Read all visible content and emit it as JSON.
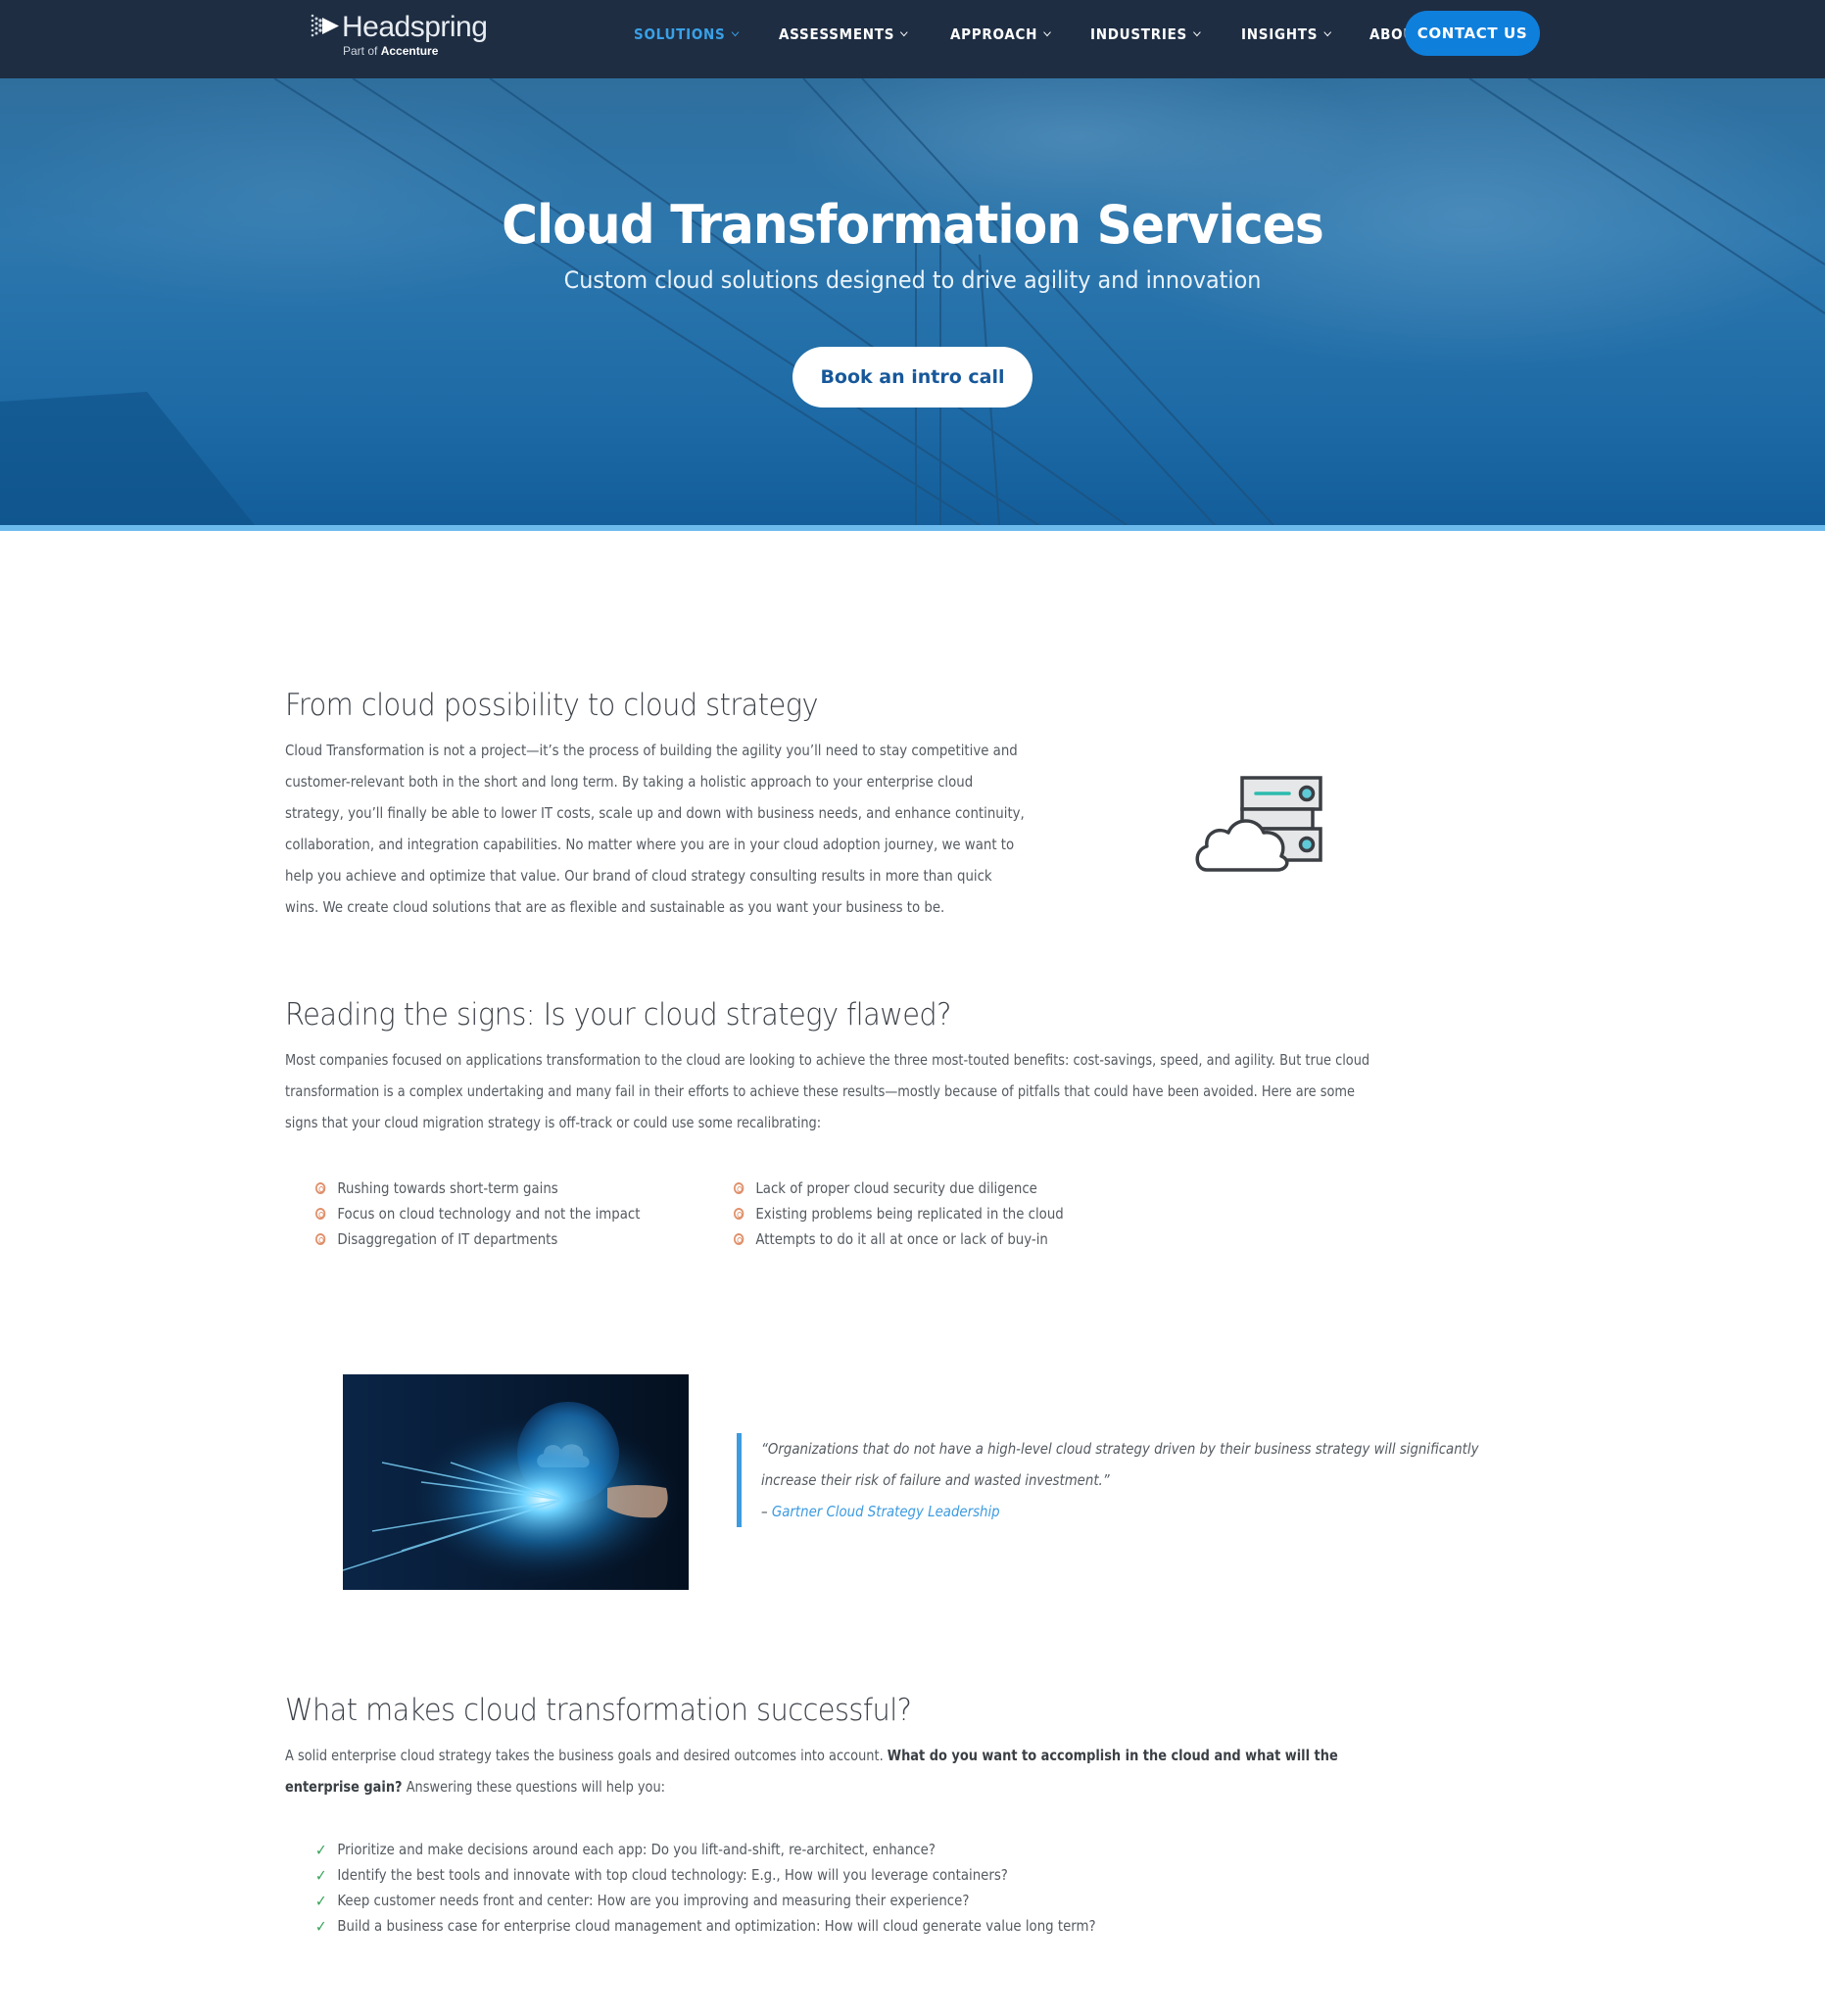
{
  "nav": {
    "logo": {
      "name": "Headspring",
      "sub_prefix": "Part of",
      "sub_brand": "Accenture"
    },
    "items": [
      {
        "label": "SOLUTIONS",
        "active": true
      },
      {
        "label": "ASSESSMENTS",
        "active": false
      },
      {
        "label": "APPROACH",
        "active": false
      },
      {
        "label": "INDUSTRIES",
        "active": false
      },
      {
        "label": "INSIGHTS",
        "active": false
      },
      {
        "label": "ABOUT",
        "active": false
      }
    ],
    "contact_label": "CONTACT US"
  },
  "hero": {
    "title": "Cloud Transformation Services",
    "subtitle": "Custom cloud solutions designed to drive agility and innovation",
    "cta_label": "Book an intro call"
  },
  "section1": {
    "heading": "From cloud possibility to cloud strategy",
    "lines": [
      "Cloud Transformation is not a project—it’s the process of building the agility you’ll need to stay competitive and",
      "customer-relevant both in the short and long term. By taking a holistic approach to your enterprise cloud",
      "strategy, you’ll finally be able to lower IT costs, scale up and down with business needs, and enhance continuity,",
      "collaboration, and integration capabilities. No matter where you are in your cloud adoption journey, we want to",
      "help you achieve and optimize that value. Our brand of cloud strategy consulting results in more than quick",
      "wins. We create cloud solutions that are as flexible and sustainable as you want your business to be."
    ],
    "icon": "cloud-server-icon"
  },
  "section2": {
    "heading": "Reading the signs: Is your cloud strategy flawed?",
    "lines": [
      "Most companies focused on applications transformation to the cloud are looking to achieve the three most-touted benefits: cost-savings, speed, and agility. But true cloud",
      "transformation is a complex undertaking and many fail in their efforts to achieve these results—mostly because of pitfalls that could have been avoided. Here are some",
      "signs that your cloud migration strategy is off-track or could use some recalibrating:"
    ],
    "signs_left": [
      "Rushing towards short-term gains",
      "Focus on cloud technology and not the impact",
      "Disaggregation of IT departments"
    ],
    "signs_right": [
      "Lack of proper cloud security due diligence",
      "Existing problems being replicated in the cloud",
      "Attempts to do it all at once or lack of buy-in"
    ]
  },
  "quote": {
    "line1": "“Organizations that do not have a high-level cloud strategy driven by their business strategy will significantly",
    "line2": "increase their risk of failure and wasted investment.”",
    "dash": "– ",
    "source": "Gartner Cloud Strategy Leadership",
    "image": "digital-cloud-globe-photo"
  },
  "section3": {
    "heading": "What makes cloud transformation successful?",
    "line1_normal": "A solid enterprise cloud strategy takes the business goals and desired outcomes into account. ",
    "line1_bold": "What do you want to accomplish in the cloud and what will the",
    "line2_bold": "enterprise gain?",
    "line2_normal": " Answering these questions will help you:",
    "checklist": [
      "Prioritize and make decisions around each app: Do you lift-and-shift, re-architect, enhance?",
      "Identify the best tools and innovate with top cloud technology: E.g., How will you leverage containers?",
      "Keep customer needs front and center: How are you improving and measuring their experience?",
      "Build a business case for enterprise cloud management and optimization: How will cloud generate value long term?"
    ]
  },
  "colors": {
    "nav_bg": "#1e2d42",
    "accent_blue": "#0f7fdc",
    "active_link": "#3aa0e6",
    "hero_blue": "#2d77ad",
    "stripe": "#6dbbec",
    "bullet_orange": "#e0906b",
    "check_green": "#37a35a",
    "quote_bar": "#3d9be0"
  }
}
